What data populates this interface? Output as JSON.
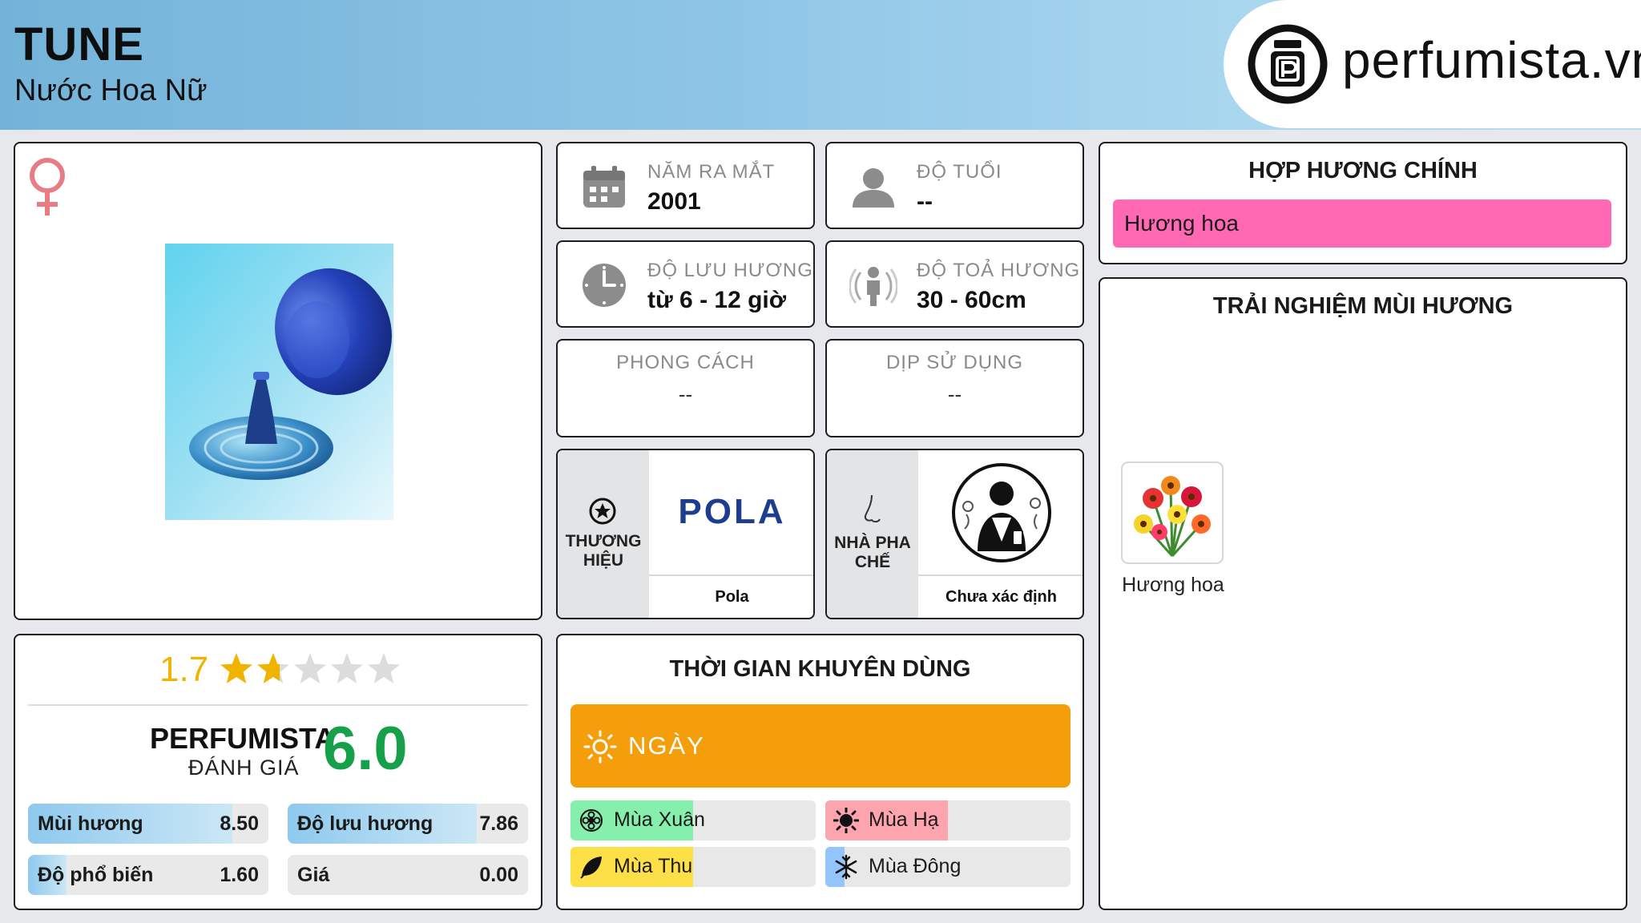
{
  "header": {
    "title": "TUNE",
    "subtitle": "Nước Hoa Nữ",
    "logo_text": "perfumista.vn"
  },
  "product": {
    "gender_icon": "female-symbol-icon",
    "image": "blue-perfume-bottle-photo"
  },
  "stats": {
    "launch_year": {
      "label": "NĂM RA MẮT",
      "value": "2001"
    },
    "age": {
      "label": "ĐỘ TUỔI",
      "value": "--"
    },
    "longevity": {
      "label": "ĐỘ LƯU HƯƠNG",
      "value": "từ 6 - 12 giờ"
    },
    "sillage": {
      "label": "ĐỘ TOẢ HƯƠNG",
      "value": "30 - 60cm"
    },
    "style": {
      "label": "PHONG CÁCH",
      "value": "--"
    },
    "occasion": {
      "label": "DỊP SỬ DỤNG",
      "value": "--"
    }
  },
  "brand": {
    "label_line1": "THƯƠNG",
    "label_line2": "HIỆU",
    "logo": "POLA",
    "name": "Pola"
  },
  "perfumer": {
    "label_line1": "NHÀ PHA",
    "label_line2": "CHẾ",
    "name": "Chưa xác định"
  },
  "accords": {
    "title": "HỢP HƯƠNG CHÍNH",
    "items": [
      {
        "name": "Hương hoa",
        "color": "#ff69b4"
      }
    ]
  },
  "experience": {
    "title": "TRẢI NGHIỆM MÙI HƯƠNG",
    "items": [
      {
        "name": "Hương hoa"
      }
    ]
  },
  "rating": {
    "user_score": "1.7",
    "user_stars": 1.7,
    "max_stars": 5,
    "perfumista_label": "PERFUMISTA",
    "perfumista_sub": "ĐÁNH GIÁ",
    "perfumista_score": "6.0",
    "bars": [
      {
        "label": "Mùi hương",
        "value": "8.50",
        "fraction": 0.85
      },
      {
        "label": "Độ lưu hương",
        "value": "7.86",
        "fraction": 0.786
      },
      {
        "label": "Độ phổ biến",
        "value": "1.60",
        "fraction": 0.16
      },
      {
        "label": "Giá",
        "value": "0.00",
        "fraction": 0.0
      }
    ]
  },
  "usage": {
    "title": "THỜI GIAN KHUYÊN DÙNG",
    "day_label": "NGÀY",
    "day_color": "#f59e0b",
    "seasons": [
      {
        "label": "Mùa Xuân",
        "fraction": 0.5,
        "color": "#86efac"
      },
      {
        "label": "Mùa Hạ",
        "fraction": 0.5,
        "color": "#fda4af"
      },
      {
        "label": "Mùa Thu",
        "fraction": 0.5,
        "color": "#fde047"
      },
      {
        "label": "Mùa Đông",
        "fraction": 0.08,
        "color": "#93c5fd"
      }
    ]
  }
}
